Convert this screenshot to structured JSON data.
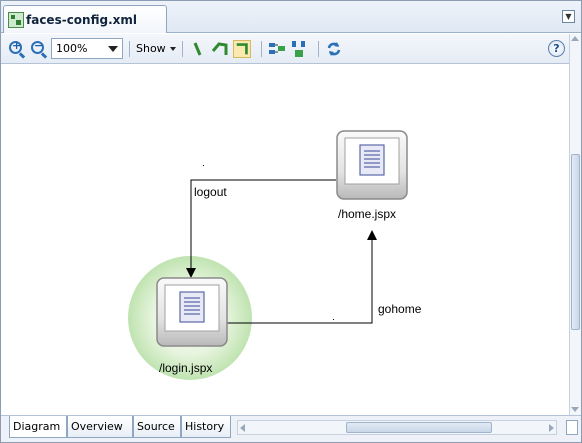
{
  "editor": {
    "tab_title": "faces-config.xml",
    "tab_icon": "faces-config-icon"
  },
  "toolbar": {
    "zoom_value": "100%",
    "show_label": "Show",
    "icons": [
      "zoom-in-icon",
      "zoom-out-icon",
      "straight-line-icon",
      "polyline-icon",
      "orthogonal-line-icon",
      "layout-horizontal-icon",
      "layout-vertical-icon",
      "refresh-icon",
      "help-icon"
    ],
    "help_label": "?"
  },
  "diagram": {
    "nodes": [
      {
        "id": "home",
        "label": "/home.jspx",
        "selected": false
      },
      {
        "id": "login",
        "label": "/login.jspx",
        "selected": true
      }
    ],
    "cases": [
      {
        "label": "logout",
        "from": "home",
        "to": "login"
      },
      {
        "label": "gohome",
        "from": "login",
        "to": "home"
      }
    ],
    "colors": {
      "edge": "#000000",
      "node_frame": "#8a8a8a",
      "selection_halo": "#bfe3b0",
      "page_icon": "#5b68a8"
    }
  },
  "bottom_tabs": [
    "Diagram",
    "Overview",
    "Source",
    "History"
  ],
  "active_bottom_tab": "Diagram"
}
